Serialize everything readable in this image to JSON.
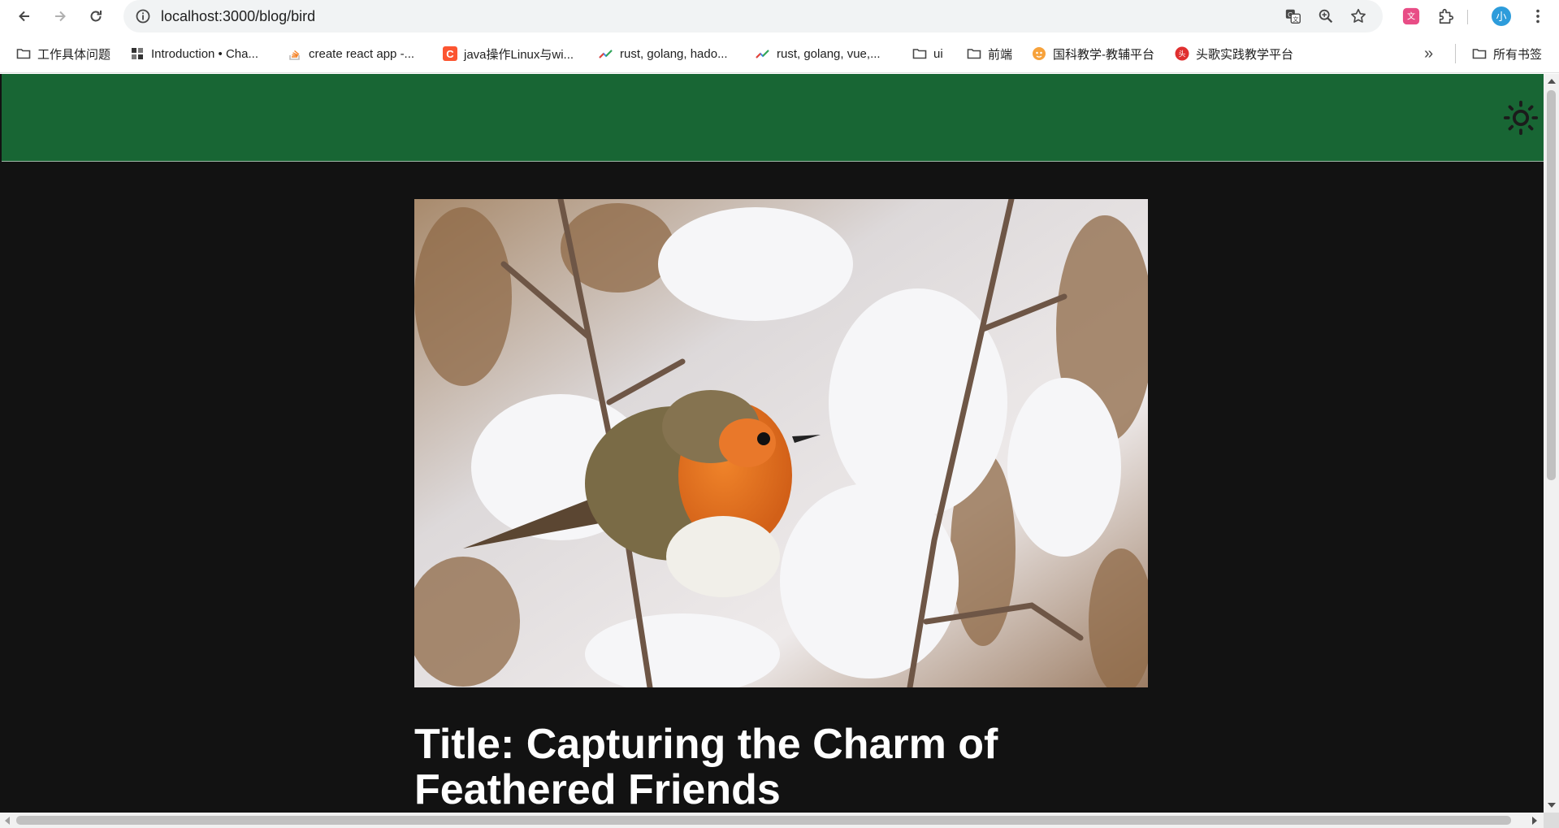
{
  "browser": {
    "url": "localhost:3000/blog/bird",
    "bookmarks": [
      {
        "label": "工作具体问题",
        "icon": "folder-icon"
      },
      {
        "label": "Introduction • Cha...",
        "icon": "site-favicon-icon"
      },
      {
        "label": "create react app -...",
        "icon": "stackoverflow-icon"
      },
      {
        "label": "java操作Linux与wi...",
        "icon": "csdn-icon"
      },
      {
        "label": "rust, golang, hado...",
        "icon": "trend-icon"
      },
      {
        "label": "rust, golang, vue,...",
        "icon": "trend-icon"
      },
      {
        "label": "ui",
        "icon": "folder-icon"
      },
      {
        "label": "前端",
        "icon": "folder-icon"
      },
      {
        "label": "国科教学-教辅平台",
        "icon": "site-favicon-icon"
      },
      {
        "label": "头歌实践教学平台",
        "icon": "site-favicon-icon"
      }
    ],
    "all_bookmarks": "所有书签"
  },
  "page": {
    "header_color": "#186634",
    "background": "#121212",
    "title": "Title: Capturing the Charm of Feathered Friends"
  }
}
